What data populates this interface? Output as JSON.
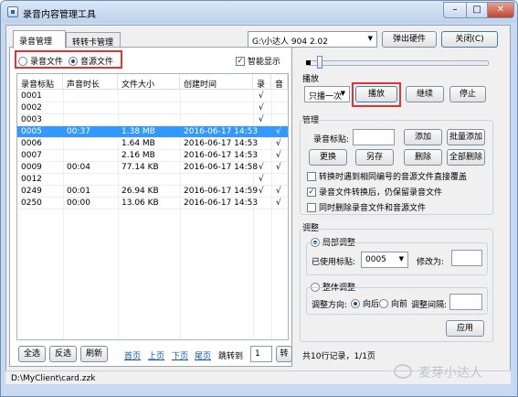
{
  "window": {
    "title": "录音内容管理工具"
  },
  "tabs": [
    {
      "label": "录音管理"
    },
    {
      "label": "转转卡管理"
    }
  ],
  "top": {
    "device": "G:\\小达人 904 2.02",
    "eject": "弹出硬件",
    "close": "关闭(C)"
  },
  "filter": {
    "record": "录音文件",
    "source": "音源文件",
    "smart": "智能显示"
  },
  "table": {
    "headers": [
      "录音标贴",
      "声音时长",
      "文件大小",
      "创建时间",
      "录",
      "音"
    ],
    "rows": [
      {
        "id": "0001",
        "dur": "",
        "size": "",
        "time": "",
        "rec": "√",
        "src": ""
      },
      {
        "id": "0002",
        "dur": "",
        "size": "",
        "time": "",
        "rec": "√",
        "src": ""
      },
      {
        "id": "0003",
        "dur": "",
        "size": "",
        "time": "",
        "rec": "√",
        "src": ""
      },
      {
        "id": "0005",
        "dur": "00:37",
        "size": "1.38 MB",
        "time": "2016-06-17 14:53",
        "rec": "",
        "src": "√"
      },
      {
        "id": "0006",
        "dur": "",
        "size": "1.64 MB",
        "time": "2016-06-17 14:53",
        "rec": "",
        "src": "√"
      },
      {
        "id": "0007",
        "dur": "",
        "size": "2.16 MB",
        "time": "2016-06-17 14:53",
        "rec": "",
        "src": "√"
      },
      {
        "id": "0009",
        "dur": "00:04",
        "size": "77.14 KB",
        "time": "2016-06-17 14:58",
        "rec": "√",
        "src": "√"
      },
      {
        "id": "0012",
        "dur": "",
        "size": "",
        "time": "",
        "rec": "√",
        "src": ""
      },
      {
        "id": "0249",
        "dur": "00:01",
        "size": "26.94 KB",
        "time": "2016-06-17 14:59",
        "rec": "√",
        "src": "√"
      },
      {
        "id": "0250",
        "dur": "00:00",
        "size": "13.06 KB",
        "time": "2016-06-17 14:53",
        "rec": "",
        "src": "√"
      }
    ],
    "selected_index": 3
  },
  "bottom": {
    "select_all": "全选",
    "invert": "反选",
    "refresh": "刷新",
    "first": "首页",
    "prev": "上页",
    "next": "下页",
    "last": "尾页",
    "goto": "跳转到",
    "page": "1",
    "go": "转"
  },
  "play": {
    "title": "播放",
    "mode": "只播一次",
    "play": "播放",
    "resume": "继续",
    "stop": "停止",
    "progress": 0.06
  },
  "manage": {
    "title": "管理",
    "label_text": "录音标贴:",
    "label_value": "",
    "add": "添加",
    "batch_add": "批量添加",
    "replace": "更换",
    "save_as": "另存",
    "delete": "删除",
    "delete_all": "全部删除",
    "opt1": "转换时遇到相同编号的音源文件直接覆盖",
    "opt2": "录音文件转换后，仍保留录音文件",
    "opt3": "同时删除录音文件和音源文件",
    "opt1_checked": false,
    "opt2_checked": true,
    "opt3_checked": false
  },
  "adjust": {
    "title": "调整",
    "local": "局部调整",
    "used_label": "已使用标贴:",
    "used_value": "0005",
    "change_to": "修改为:",
    "change_value": "",
    "global": "整体调整",
    "direction": "调整方向:",
    "backward": "向后",
    "forward": "向前",
    "interval": "调整间隔:",
    "interval_value": "",
    "apply": "应用"
  },
  "summary": "共10行记录，1/1页",
  "status": {
    "path": "D:\\MyClient\\card.zzk"
  },
  "watermark": "麦芽小达人"
}
